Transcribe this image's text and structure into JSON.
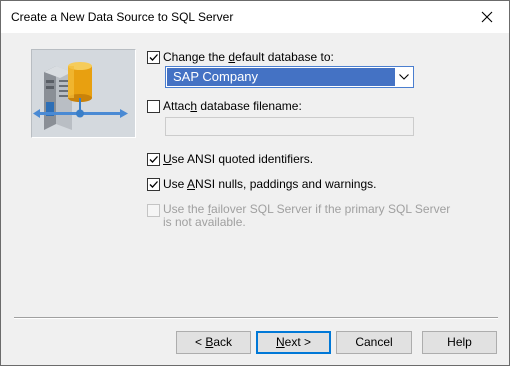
{
  "window": {
    "title": "Create a New Data Source to SQL Server"
  },
  "art": {
    "icon": "database-server-network-icon"
  },
  "options": {
    "change_default_db": {
      "checked": true,
      "label_pre": "Change the ",
      "label_mnemonic": "d",
      "label_post": "efault database to:"
    },
    "database_combo": {
      "selected": "SAP Company"
    },
    "attach_db": {
      "checked": false,
      "label_pre": "Attac",
      "label_mnemonic": "h",
      "label_post": " database filename:"
    },
    "attach_filename_value": "",
    "ansi_quoted": {
      "checked": true,
      "label_pre": "",
      "label_mnemonic": "U",
      "label_post": "se ANSI quoted identifiers."
    },
    "ansi_nulls": {
      "checked": true,
      "label_pre": "Use ",
      "label_mnemonic": "A",
      "label_post": "NSI nulls, paddings and warnings."
    },
    "failover": {
      "checked": false,
      "disabled": true,
      "label_pre": "Use the ",
      "label_mnemonic": "f",
      "label_post": "ailover SQL Server if the primary SQL Server is not available."
    }
  },
  "buttons": {
    "back_pre": "< ",
    "back_mnemonic": "B",
    "back_post": "ack",
    "next_mnemonic": "N",
    "next_post": "ext >",
    "cancel": "Cancel",
    "help": "Help"
  }
}
